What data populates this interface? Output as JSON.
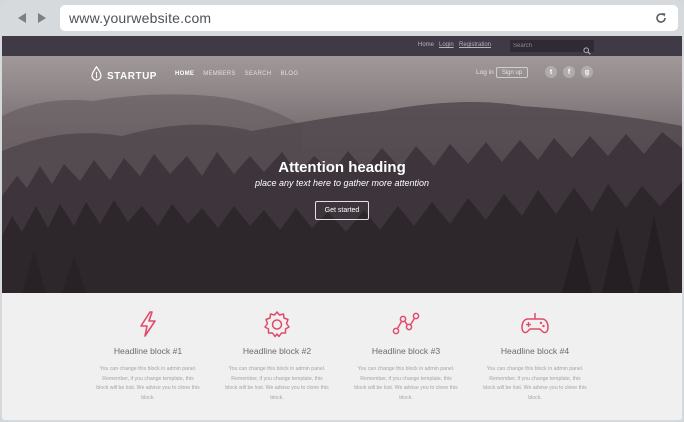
{
  "browser": {
    "url": "www.yourwebsite.com",
    "back_icon": "back-arrow-icon",
    "forward_icon": "forward-arrow-icon",
    "reload_icon": "reload-icon"
  },
  "topbar": {
    "links": [
      "Home",
      "Login",
      "Registration"
    ],
    "search_placeholder": "Search"
  },
  "header": {
    "brand": "STARTUP",
    "nav": [
      "HOME",
      "MEMBERS",
      "SEARCH",
      "BLOG"
    ],
    "active_nav": "HOME",
    "login": "Log in",
    "signup": "Sign up",
    "social": [
      {
        "name": "twitter-icon",
        "glyph": "t"
      },
      {
        "name": "facebook-icon",
        "glyph": "f"
      },
      {
        "name": "google-plus-icon",
        "glyph": "g"
      }
    ]
  },
  "hero": {
    "title": "Attention heading",
    "subtitle": "place any text here to gather more attention",
    "cta": "Get started"
  },
  "features": [
    {
      "icon": "lightning-icon",
      "title": "Headline block #1",
      "text": "You can change this block in admin panel. Remember, if you change template, this block will be lost. We advise you to clone this block."
    },
    {
      "icon": "gear-icon",
      "title": "Headline block #2",
      "text": "You can change this block in admin panel. Remember, if you change template, this block will be lost. We advise you to clone this block."
    },
    {
      "icon": "graph-icon",
      "title": "Headline block #3",
      "text": "You can change this block in admin panel. Remember, if you change template, this block will be lost. We advise you to clone this block."
    },
    {
      "icon": "gamepad-icon",
      "title": "Headline block #4",
      "text": "You can change this block in admin panel. Remember, if you change template, this block will be lost. We advise you to clone this block."
    }
  ],
  "colors": {
    "accent": "#e04a6b",
    "topbar": "#3f3a45",
    "features_bg": "#f0f0f0"
  }
}
